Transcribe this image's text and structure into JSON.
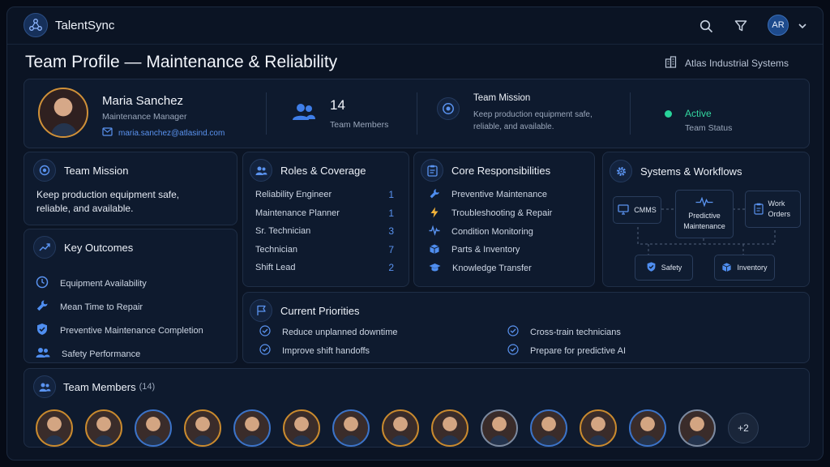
{
  "app": {
    "brand": "TalentSync",
    "user_initials": "AR"
  },
  "page": {
    "title": "Team Profile — Maintenance & Reliability",
    "company": "Atlas Industrial Systems"
  },
  "summary": {
    "leader_name": "Maria Sanchez",
    "leader_role": "Maintenance Manager",
    "leader_email": "maria.sanchez@atlasind.com",
    "member_count": "14",
    "member_count_label": "Team Members",
    "mission_title": "Team Mission",
    "mission_text": "Keep production equipment safe, reliable, and available.",
    "status": "Active",
    "status_label": "Team Status"
  },
  "mission": {
    "title": "Team Mission",
    "text": "Keep production equipment safe, reliable, and available."
  },
  "outcomes": {
    "title": "Key Outcomes",
    "items": [
      {
        "label": "Equipment Availability",
        "icon": "clock-icon"
      },
      {
        "label": "Mean Time to Repair",
        "icon": "wrench-icon"
      },
      {
        "label": "Preventive Maintenance Completion",
        "icon": "shield-icon"
      },
      {
        "label": "Safety Performance",
        "icon": "people-icon"
      }
    ]
  },
  "roles": {
    "title": "Roles & Coverage",
    "items": [
      {
        "role": "Reliability Engineer",
        "count": "1"
      },
      {
        "role": "Maintenance Planner",
        "count": "1"
      },
      {
        "role": "Sr. Technician",
        "count": "3"
      },
      {
        "role": "Technician",
        "count": "7"
      },
      {
        "role": "Shift Lead",
        "count": "2"
      }
    ]
  },
  "responsibilities": {
    "title": "Core Responsibilities",
    "items": [
      {
        "label": "Preventive Maintenance",
        "icon": "wrench-icon"
      },
      {
        "label": "Troubleshooting & Repair",
        "icon": "bolt-icon"
      },
      {
        "label": "Condition Monitoring",
        "icon": "pulse-icon"
      },
      {
        "label": "Parts & Inventory",
        "icon": "box-icon"
      },
      {
        "label": "Knowledge Transfer",
        "icon": "graduation-cap-icon"
      }
    ]
  },
  "systems": {
    "title": "Systems & Workflows",
    "cmms": "CMMS",
    "predictive": "Predictive Maintenance",
    "work_orders": "Work Orders",
    "safety": "Safety",
    "inventory": "Inventory"
  },
  "priorities": {
    "title": "Current Priorities",
    "items": [
      "Reduce unplanned downtime",
      "Improve shift handoffs",
      "Cross-train technicians",
      "Prepare for predictive AI"
    ]
  },
  "members": {
    "title": "Team Members",
    "count": "(14)",
    "more": "+2"
  },
  "colors": {
    "accent": "#4f8ef0",
    "active": "#28d39a",
    "warning": "#f2b33a",
    "background": "#0b1424"
  }
}
